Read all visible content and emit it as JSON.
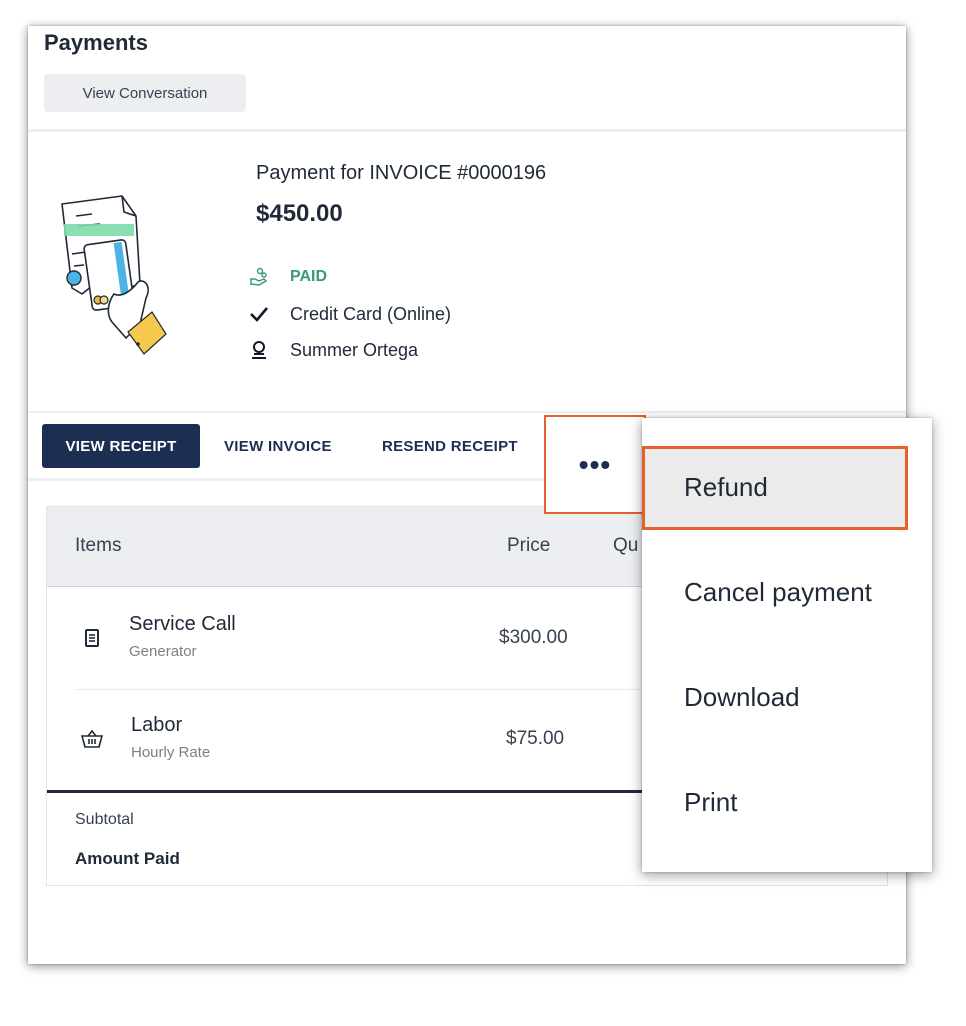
{
  "page": {
    "title": "Payments",
    "view_conversation_label": "View Conversation"
  },
  "payment": {
    "title": "Payment for INVOICE #0000196",
    "amount": "$450.00",
    "status": "PAID",
    "method": "Credit Card (Online)",
    "customer": "Summer Ortega"
  },
  "actions": {
    "view_receipt": "VIEW RECEIPT",
    "view_invoice": "VIEW INVOICE",
    "resend_receipt": "RESEND RECEIPT",
    "more": "•••"
  },
  "table": {
    "headers": {
      "items": "Items",
      "price": "Price",
      "qty": "Qu"
    },
    "rows": [
      {
        "name": "Service Call",
        "sub": "Generator",
        "price": "$300.00",
        "icon": "receipt-icon"
      },
      {
        "name": "Labor",
        "sub": "Hourly Rate",
        "price": "$75.00",
        "icon": "basket-icon"
      }
    ],
    "subtotal_label": "Subtotal",
    "amount_paid_label": "Amount Paid"
  },
  "menu": {
    "items": [
      "Refund",
      "Cancel payment",
      "Download",
      "Print"
    ],
    "highlighted": "Refund"
  },
  "colors": {
    "primary": "#1c2e52",
    "paid_green": "#3a9a72",
    "highlight_orange": "#e5602a"
  }
}
